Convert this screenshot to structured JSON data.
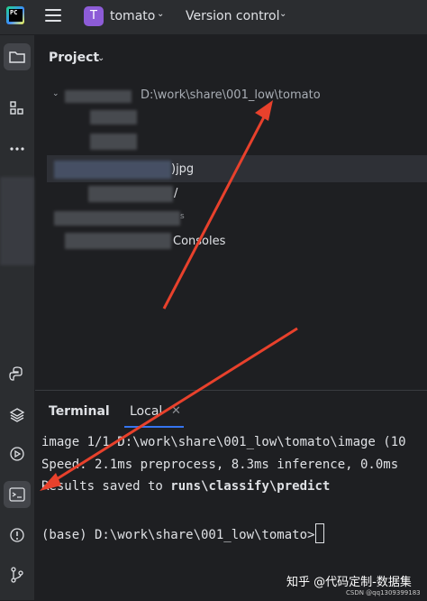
{
  "topbar": {
    "logo_text": "PC",
    "project_badge": "T",
    "project_name": "tomato",
    "vcs_label": "Version control"
  },
  "project_panel": {
    "title": "Project",
    "root_path": "D:\\work\\share\\001_low\\tomato",
    "visible_items": [
      ")jpg",
      "/",
      "s",
      "Consoles"
    ]
  },
  "terminal": {
    "tab_title": "Terminal",
    "tab_local": "Local",
    "line1": "image 1/1 D:\\work\\share\\001_low\\tomato\\image (10",
    "line2": "Speed: 2.1ms preprocess, 8.3ms inference, 0.0ms",
    "line3_prefix": "Results saved to ",
    "line3_bold": "runs\\classify\\predict",
    "line4": "(base) D:\\work\\share\\001_low\\tomato>"
  },
  "watermark": {
    "main": "知乎 @代码定制-数据集",
    "sub": "CSDN @qq1309399183"
  },
  "colors": {
    "background": "#1e1f22",
    "panel": "#2b2d30",
    "accent": "#3574f0",
    "annotation_arrow": "#e8412c",
    "project_badge": "#8d5cd7"
  }
}
